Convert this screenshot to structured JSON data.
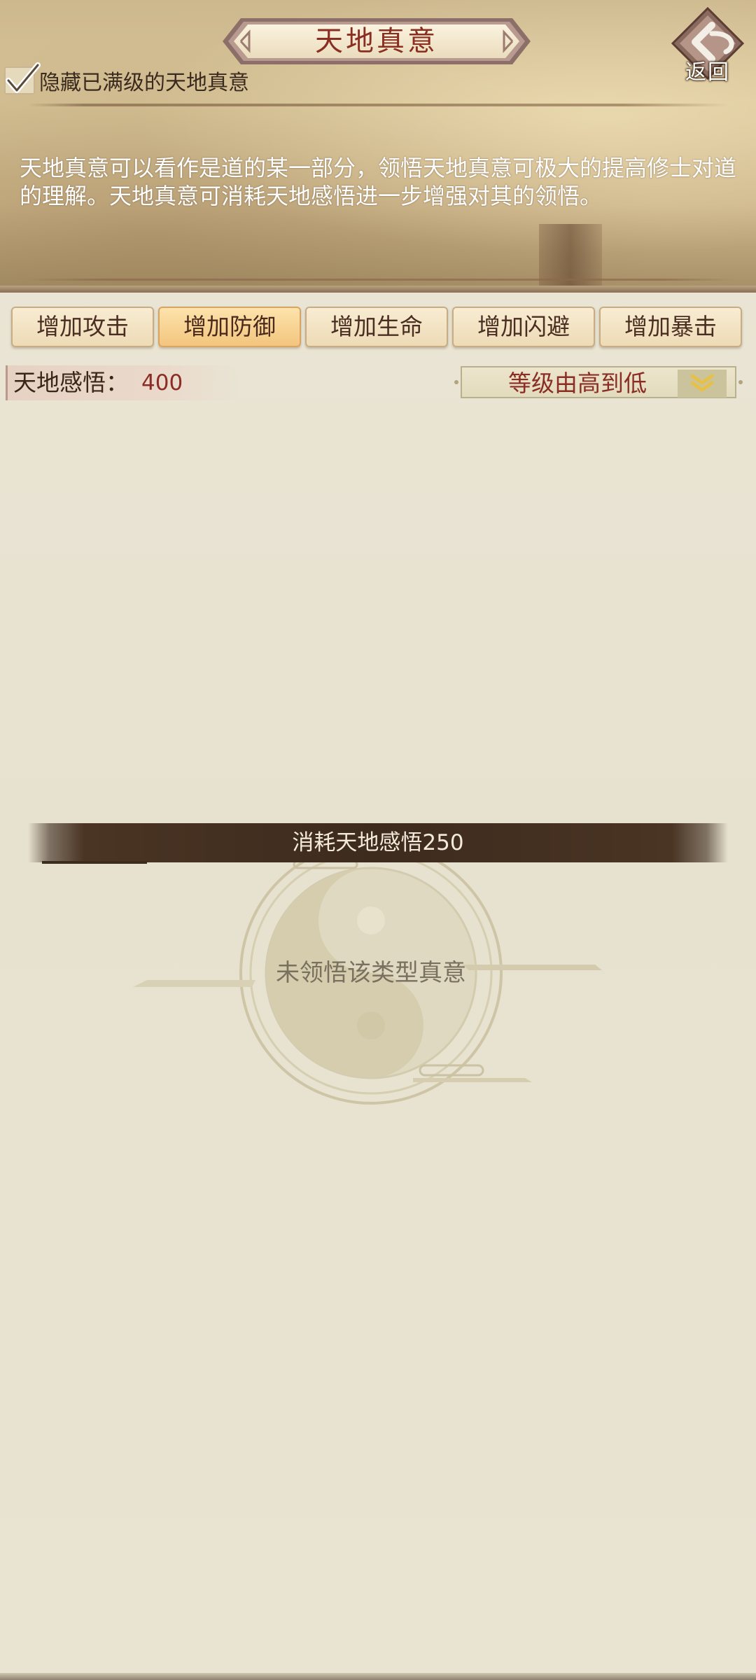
{
  "header": {
    "title": "天地真意",
    "back_label": "返回",
    "hide_maxed_label": "隐藏已满级的天地真意",
    "hide_maxed_checked": true,
    "description": "天地真意可以看作是道的某一部分，领悟天地真意可极大的提高修士对道的理解。天地真意可消耗天地感悟进一步增强对其的领悟。"
  },
  "tabs": [
    {
      "label": "增加攻击",
      "active": false
    },
    {
      "label": "增加防御",
      "active": true
    },
    {
      "label": "增加生命",
      "active": false
    },
    {
      "label": "增加闪避",
      "active": false
    },
    {
      "label": "增加暴击",
      "active": false
    }
  ],
  "resource": {
    "label": "天地感悟：",
    "value": "400"
  },
  "sort": {
    "selected": "等级由高到低"
  },
  "cost_bar": {
    "text": "消耗天地感悟250"
  },
  "empty_state": {
    "text": "未领悟该类型真意"
  },
  "colors": {
    "title_red": "#8a2e22",
    "active_tab": "#f3c57e",
    "cost_bar": "#3d2b1e",
    "background": "#e9e3d2"
  }
}
